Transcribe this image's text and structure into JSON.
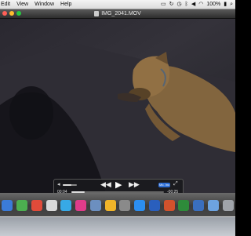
{
  "menubar": {
    "items": [
      "Edit",
      "View",
      "Window",
      "Help"
    ],
    "status_icons": [
      "display-icon",
      "sync-icon",
      "timemachine-icon",
      "bluetooth-icon",
      "volume-icon",
      "wifi-icon",
      "battery-icon",
      "search-icon"
    ],
    "battery_percent": "100%"
  },
  "window": {
    "title": "IMG_2041.MOV"
  },
  "player": {
    "elapsed": "00:04",
    "remaining": "-00:25",
    "progress_fraction": 0.14,
    "volume_fraction": 0.6,
    "share_label": "Mo. Inc"
  },
  "dock": {
    "apps": [
      {
        "name": "finder",
        "color": "#3b7bd8"
      },
      {
        "name": "facetime",
        "color": "#4caf50"
      },
      {
        "name": "chrome",
        "color": "#e04b3a"
      },
      {
        "name": "calendar",
        "color": "#d9d9d9"
      },
      {
        "name": "messages",
        "color": "#37a9e6"
      },
      {
        "name": "itunes",
        "color": "#e03c8a"
      },
      {
        "name": "preview",
        "color": "#6c8fbf"
      },
      {
        "name": "photos",
        "color": "#f0b429"
      },
      {
        "name": "system-preferences",
        "color": "#8a8a8a"
      },
      {
        "name": "app-store",
        "color": "#2c8ef0"
      },
      {
        "name": "word",
        "color": "#2a5fbd"
      },
      {
        "name": "powerpoint",
        "color": "#d2522c"
      },
      {
        "name": "excel",
        "color": "#2e8b3a"
      },
      {
        "name": "quicktime",
        "color": "#3a6fbf"
      },
      {
        "name": "folder",
        "color": "#6da3e0"
      },
      {
        "name": "trash",
        "color": "#a0a4aa"
      }
    ]
  }
}
